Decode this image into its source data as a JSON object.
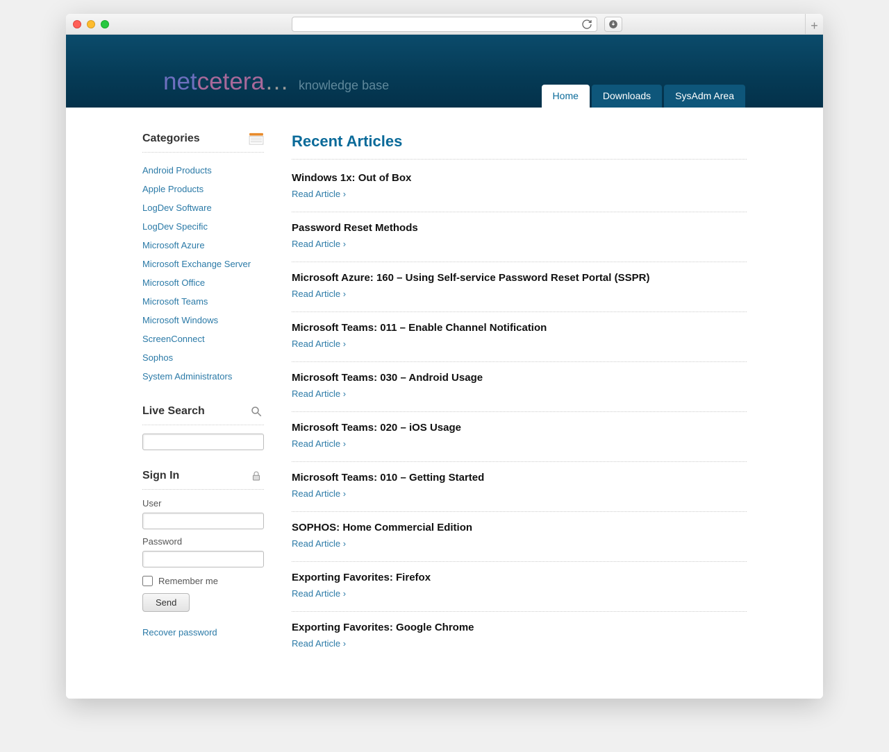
{
  "brand": {
    "net": "net",
    "cetera": "cetera",
    "dots": "…",
    "tagline": "knowledge base"
  },
  "nav": {
    "tabs": [
      {
        "label": "Home",
        "active": true
      },
      {
        "label": "Downloads",
        "active": false
      },
      {
        "label": "SysAdm Area",
        "active": false
      }
    ]
  },
  "sidebar": {
    "categories_title": "Categories",
    "categories": [
      "Android Products",
      "Apple Products",
      "LogDev Software",
      "LogDev Specific",
      "Microsoft Azure",
      "Microsoft Exchange Server",
      "Microsoft Office",
      "Microsoft Teams",
      "Microsoft Windows",
      "ScreenConnect",
      "Sophos",
      "System Administrators"
    ],
    "search_title": "Live Search",
    "signin_title": "Sign In",
    "user_label": "User",
    "password_label": "Password",
    "remember_label": "Remember me",
    "send_label": "Send",
    "recover_label": "Recover password"
  },
  "main": {
    "heading": "Recent Articles",
    "read_label": "Read Article",
    "articles": [
      "Windows 1x: Out of Box",
      "Password Reset Methods",
      "Microsoft Azure: 160 – Using Self-service Password Reset Portal (SSPR)",
      "Microsoft Teams: 011 – Enable Channel Notification",
      "Microsoft Teams: 030 – Android Usage",
      "Microsoft Teams: 020 – iOS Usage",
      "Microsoft Teams: 010 – Getting Started",
      "SOPHOS: Home Commercial Edition",
      "Exporting Favorites: Firefox",
      "Exporting Favorites: Google Chrome"
    ]
  }
}
